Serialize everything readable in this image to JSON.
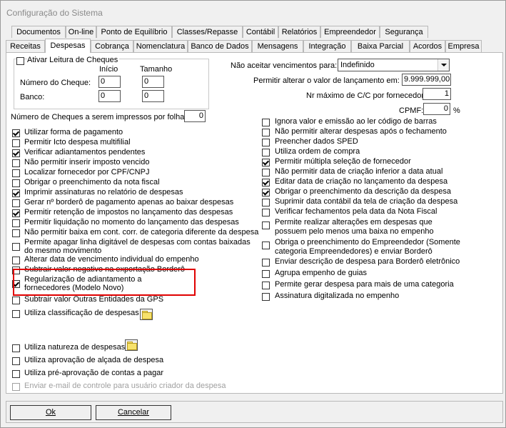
{
  "window_title": "Configuração do Sistema",
  "tabs_row1": [
    "Documentos",
    "On-line",
    "Ponto de Equilíbrio",
    "Classes/Repasse",
    "Contábil",
    "Relatórios",
    "Empreendedor",
    "Segurança"
  ],
  "tabs_row2": [
    "Receitas",
    "Despesas",
    "Cobrança",
    "Nomenclatura",
    "Banco de Dados",
    "Mensagens",
    "Integração",
    "Baixa Parcial",
    "Acordos",
    "Empresa"
  ],
  "active_tab": "Despesas",
  "cheques": {
    "label": "Ativar Leitura de Cheques",
    "checked": false,
    "inicio_label": "Início",
    "tamanho_label": "Tamanho",
    "numero_label": "Número do Cheque:",
    "banco_label": "Banco:",
    "numero_inicio": "0",
    "numero_tamanho": "0",
    "banco_inicio": "0",
    "banco_tamanho": "0"
  },
  "cheques_por_folha": {
    "label": "Número de Cheques a serem impressos por folha:",
    "value": "0"
  },
  "vencimentos": {
    "label": "Não aceitar vencimentos para:",
    "value": "Indefinido"
  },
  "alterar_valor": {
    "label": "Permitir alterar o valor de lançamento em:",
    "value": "9.999.999,00"
  },
  "max_cc": {
    "label": "Nr máximo de C/C por fornecedor:",
    "value": "1"
  },
  "cpmf": {
    "label": "CPMF:",
    "value": "0",
    "unit": "%"
  },
  "left_options": [
    {
      "label": "Utilizar forma de pagamento",
      "checked": true,
      "disabled": false
    },
    {
      "label": "Permitir Icto despesa multifilial",
      "checked": false,
      "disabled": false
    },
    {
      "label": "Verificar adiantamentos pendentes",
      "checked": true,
      "disabled": false
    },
    {
      "label": "Não permitir inserir imposto vencido",
      "checked": false,
      "disabled": false
    },
    {
      "label": "Localizar fornecedor por CPF/CNPJ",
      "checked": false,
      "disabled": false
    },
    {
      "label": "Obrigar o preenchimento da nota fiscal",
      "checked": false,
      "disabled": false
    },
    {
      "label": "Imprimir assinaturas no relatório de despesas",
      "checked": true,
      "disabled": false
    },
    {
      "label": "Gerar nº borderô de pagamento apenas ao baixar despesas",
      "checked": false,
      "disabled": false
    },
    {
      "label": "Permitir retenção de impostos no lançamento das despesas",
      "checked": true,
      "disabled": false
    },
    {
      "label": "Permitir liquidação no momento do lançamento das despesas",
      "checked": false,
      "disabled": false
    },
    {
      "label": "Não permitir baixa em cont. corr. de categoria diferente da despesa",
      "checked": false,
      "disabled": false
    },
    {
      "label": "Permite apagar linha digitável de despesas com contas baixadas do mesmo movimento",
      "checked": false,
      "disabled": false
    },
    {
      "label": "Alterar data de vencimento individual do empenho",
      "checked": false,
      "disabled": false
    },
    {
      "label": "Subtrair valor negativo na exportação Borderô",
      "checked": false,
      "disabled": false
    },
    {
      "label": "Regularização de adiantamento a fornecedores (Modelo Novo)",
      "checked": true,
      "disabled": false
    },
    {
      "label": "Subtrair valor Outras Entidades da GPS",
      "checked": false,
      "disabled": false
    },
    {
      "label": "Utiliza classificação de despesas",
      "checked": false,
      "disabled": false
    },
    {
      "label": "Utiliza natureza de despesas",
      "checked": false,
      "disabled": false
    },
    {
      "label": "Utiliza aprovação de alçada de despesa",
      "checked": false,
      "disabled": false
    },
    {
      "label": "Utiliza pré-aprovação de contas a pagar",
      "checked": false,
      "disabled": false
    },
    {
      "label": "Enviar e-mail de controle para usuário criador da despesa",
      "checked": false,
      "disabled": true
    }
  ],
  "right_options": [
    {
      "label": "Ignora valor e emissão ao ler código de barras",
      "checked": false
    },
    {
      "label": "Não permitir alterar despesas após o fechamento",
      "checked": false
    },
    {
      "label": "Preencher dados SPED",
      "checked": false
    },
    {
      "label": "Utiliza ordem de compra",
      "checked": false
    },
    {
      "label": "Permitir múltipla seleção de fornecedor",
      "checked": true
    },
    {
      "label": "Não permitir data de criação inferior a data atual",
      "checked": false
    },
    {
      "label": "Editar data de criação no lançamento da despesa",
      "checked": true
    },
    {
      "label": "Obrigar o preenchimento da descrição da despesa",
      "checked": true
    },
    {
      "label": "Suprimir data contábil da tela de criação da despesa",
      "checked": false
    },
    {
      "label": "Verificar fechamentos pela data da Nota Fiscal",
      "checked": false
    },
    {
      "label": "Permite realizar alterações em despesas que possuem pelo menos uma baixa no empenho",
      "checked": false
    },
    {
      "label": "Obriga o preenchimento do Empreendedor (Somente categoria Empreendedores) e enviar Borderô",
      "checked": false
    },
    {
      "label": "Enviar descrição de despesa para Borderô eletrônico",
      "checked": false
    },
    {
      "label": "Agrupa empenho de guias",
      "checked": false
    },
    {
      "label": "Permite gerar despesa para mais de uma categoria",
      "checked": false
    },
    {
      "label": "Assinatura digitalizada no empenho",
      "checked": false
    }
  ],
  "buttons": {
    "ok": "Ok",
    "cancel": "Cancelar"
  }
}
